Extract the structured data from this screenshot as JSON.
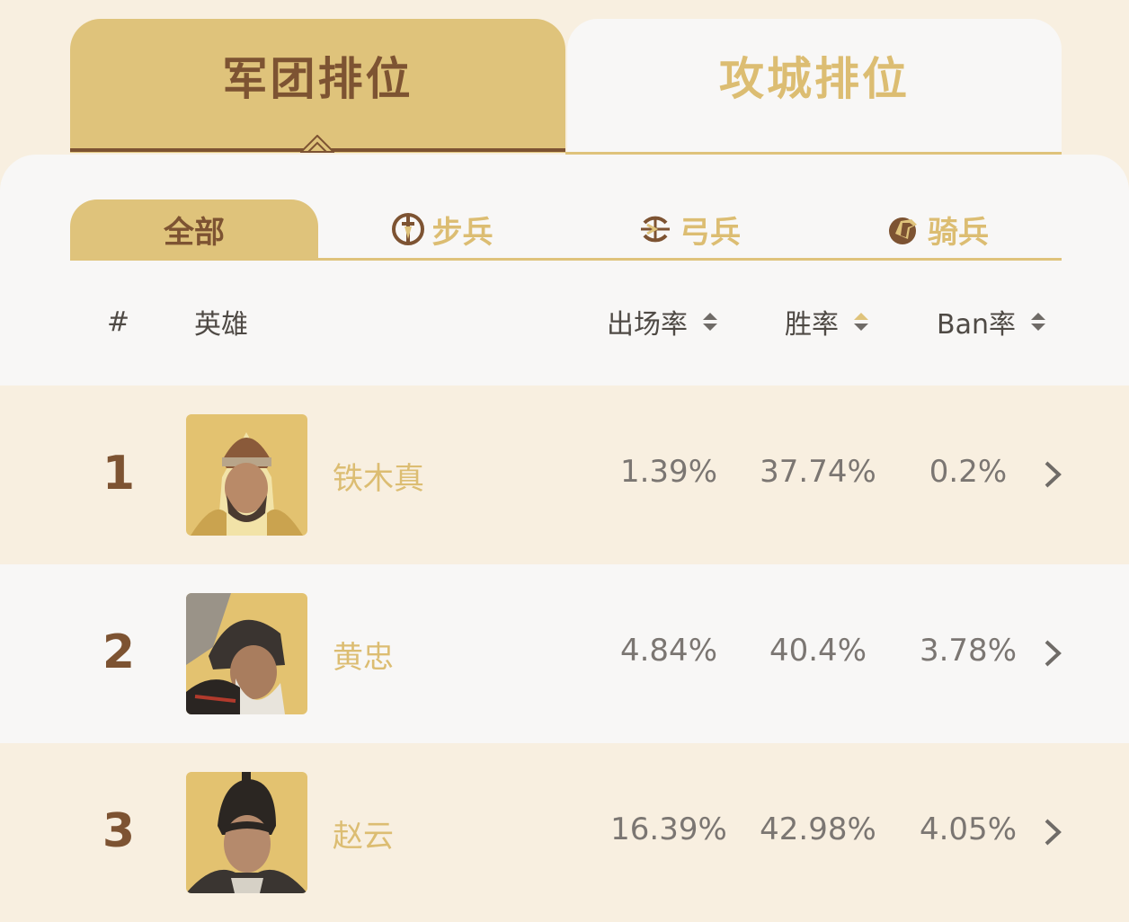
{
  "top_tabs": [
    {
      "label": "军团排位",
      "active": true
    },
    {
      "label": "攻城排位",
      "active": false
    }
  ],
  "filters": [
    {
      "label": "全部",
      "icon": "",
      "active": true
    },
    {
      "label": "步兵",
      "icon": "infantry-icon",
      "active": false
    },
    {
      "label": "弓兵",
      "icon": "archer-icon",
      "active": false
    },
    {
      "label": "骑兵",
      "icon": "cavalry-icon",
      "active": false
    }
  ],
  "table": {
    "headers": {
      "rank": "#",
      "hero": "英雄",
      "pick_rate": "出场率",
      "win_rate": "胜率",
      "ban_rate": "Ban率"
    },
    "active_sort": "win_rate",
    "rows": [
      {
        "rank": "1",
        "name": "铁木真",
        "pick_rate": "1.39%",
        "win_rate": "37.74%",
        "ban_rate": "0.2%"
      },
      {
        "rank": "2",
        "name": "黄忠",
        "pick_rate": "4.84%",
        "win_rate": "40.4%",
        "ban_rate": "3.78%"
      },
      {
        "rank": "3",
        "name": "赵云",
        "pick_rate": "16.39%",
        "win_rate": "42.98%",
        "ban_rate": "4.05%"
      }
    ]
  },
  "colors": {
    "accent": "#dfc37b",
    "brown": "#7d5332",
    "bg": "#f8efe0",
    "card": "#f8f7f6",
    "value": "#7b7672"
  }
}
